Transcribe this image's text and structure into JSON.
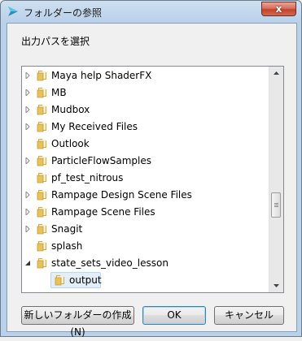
{
  "window": {
    "title": "フォルダーの参照",
    "close_glyph": "x"
  },
  "instruction": "出力パスを選択",
  "tree": {
    "items": [
      {
        "label": "Maya help ShaderFX",
        "expander": "collapsed"
      },
      {
        "label": "MB",
        "expander": "collapsed"
      },
      {
        "label": "Mudbox",
        "expander": "collapsed"
      },
      {
        "label": "My Received Files",
        "expander": "collapsed"
      },
      {
        "label": "Outlook",
        "expander": "none"
      },
      {
        "label": "ParticleFlowSamples",
        "expander": "collapsed"
      },
      {
        "label": "pf_test_nitrous",
        "expander": "none"
      },
      {
        "label": "Rampage Design Scene Files",
        "expander": "collapsed"
      },
      {
        "label": "Rampage Scene Files",
        "expander": "collapsed"
      },
      {
        "label": "Snagit",
        "expander": "collapsed"
      },
      {
        "label": "splash",
        "expander": "none"
      },
      {
        "label": "state_sets_video_lesson",
        "expander": "expanded"
      },
      {
        "label": "output",
        "expander": "none",
        "selected": true
      }
    ]
  },
  "buttons": {
    "new_folder": "新しいフォルダーの作成(N)",
    "ok": "OK",
    "cancel": "キャンセル"
  },
  "colors": {
    "title_bar": "#b9d1ea",
    "close_button": "#c3432b",
    "folder": "#e8c25a",
    "selection": "#e3eef9"
  }
}
